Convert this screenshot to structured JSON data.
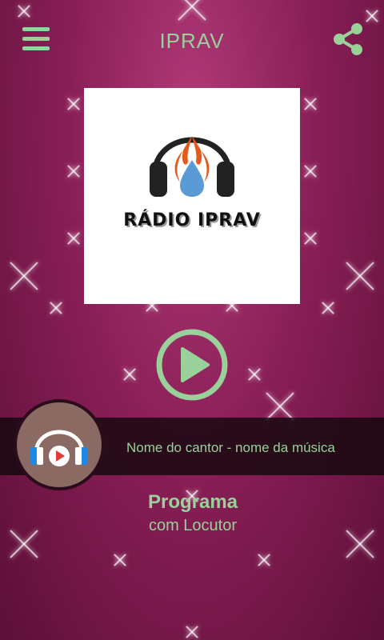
{
  "header": {
    "title": "IPRAV",
    "menu_icon": "hamburger-menu-icon",
    "share_icon": "share-icon"
  },
  "logo": {
    "text": "RÁDIO IPRAV"
  },
  "player": {
    "play_icon": "play-icon",
    "now_playing": "Nome do cantor - nome da música"
  },
  "program": {
    "name": "Programa",
    "host": "com Locutor"
  },
  "colors": {
    "accent": "#9ad09a",
    "background": "#8a1f57",
    "bar": "#1a0810"
  }
}
